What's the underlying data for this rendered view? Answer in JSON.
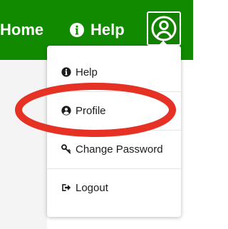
{
  "topbar": {
    "home_label": "Home",
    "help_label": "Help",
    "background": "#118a00"
  },
  "menu": {
    "items": [
      {
        "label": "Help",
        "icon": "info-circle-icon"
      },
      {
        "label": "Profile",
        "icon": "user-circle-icon"
      },
      {
        "label": "Change Password",
        "icon": "key-icon"
      },
      {
        "label": "Logout",
        "icon": "logout-icon"
      }
    ]
  },
  "annotation": {
    "shape": "ellipse",
    "color": "#e53225",
    "highlights": "Profile"
  }
}
